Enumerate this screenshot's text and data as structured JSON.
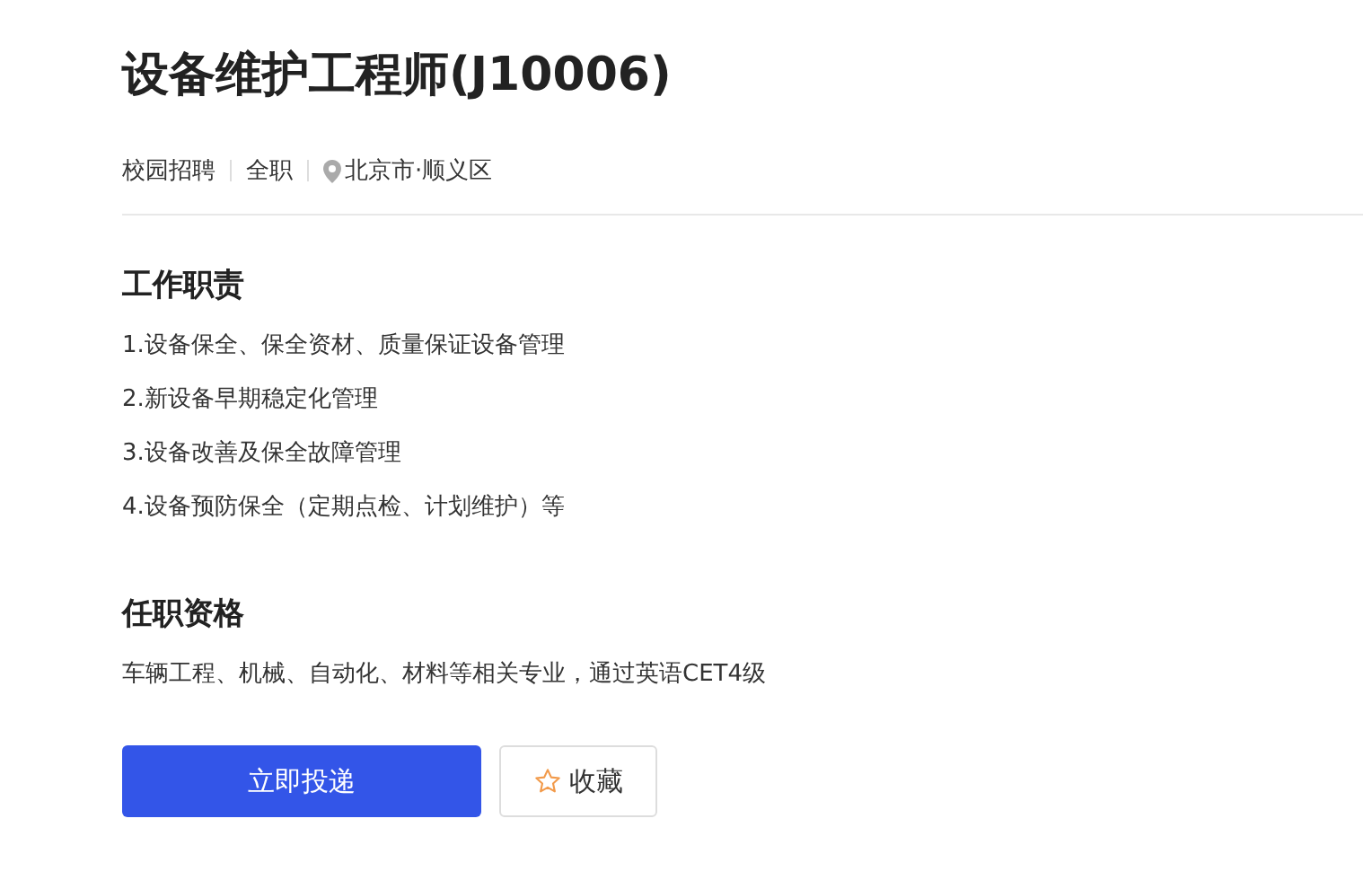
{
  "job": {
    "title": "设备维护工程师(J10006)",
    "tags": [
      {
        "kind": "text",
        "label": "校园招聘"
      },
      {
        "kind": "text",
        "label": "全职"
      },
      {
        "kind": "location",
        "label": "北京市·顺义区"
      }
    ]
  },
  "sections": [
    {
      "heading": "工作职责",
      "lines": [
        "1.设备保全、保全资材、质量保证设备管理",
        "2.新设备早期稳定化管理",
        "3.设备改善及保全故障管理",
        "4.设备预防保全（定期点检、计划维护）等"
      ]
    },
    {
      "heading": "任职资格",
      "lines": [
        "车辆工程、机械、自动化、材料等相关专业，通过英语CET4级"
      ]
    }
  ],
  "actions": {
    "apply": "立即投递",
    "favorite": "收藏"
  }
}
